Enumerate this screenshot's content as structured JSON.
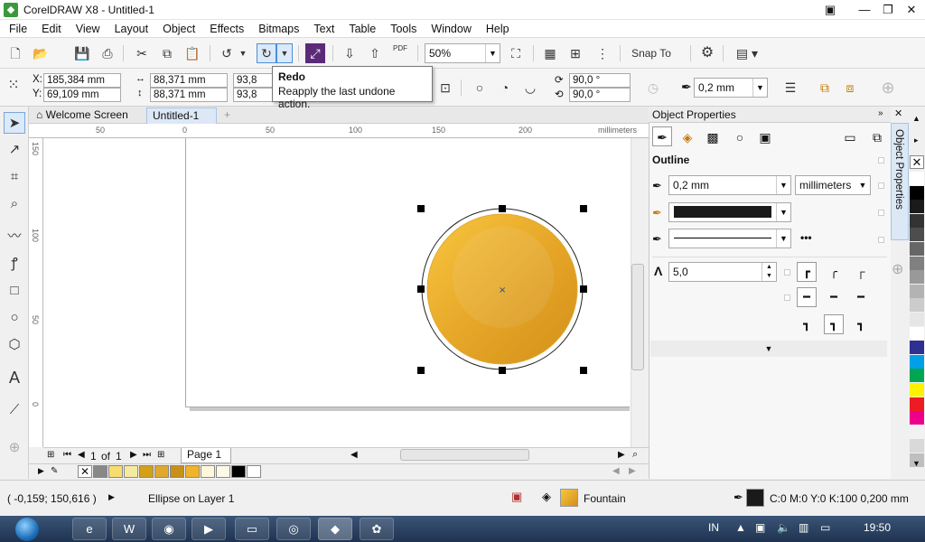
{
  "window": {
    "title": "CorelDRAW X8 - Untitled-1"
  },
  "menu": [
    "File",
    "Edit",
    "View",
    "Layout",
    "Object",
    "Effects",
    "Bitmaps",
    "Text",
    "Table",
    "Tools",
    "Window",
    "Help"
  ],
  "toolbar": {
    "zoom": "50%",
    "snap_label": "Snap To"
  },
  "tooltip": {
    "title": "Redo",
    "text": "Reapply the last undone action."
  },
  "propbar": {
    "x_label": "X:",
    "x": "185,384 mm",
    "y_label": "Y:",
    "y": "69,109 mm",
    "w": "88,371 mm",
    "h": "88,371 mm",
    "scale_w": "93,8",
    "scale_h": "93,8",
    "angle_start": "90,0 °",
    "angle_end": "90,0 °",
    "outline": "0,2 mm"
  },
  "tabs": {
    "welcome": "Welcome Screen",
    "doc": "Untitled-1"
  },
  "ruler": {
    "units": "millimeters",
    "top": [
      "50",
      "0",
      "50",
      "100",
      "150",
      "200"
    ],
    "left": [
      "150",
      "100",
      "50",
      "0"
    ]
  },
  "pagenav": {
    "current": "1",
    "of": "of",
    "total": "1",
    "page_tab": "Page 1"
  },
  "docker": {
    "title": "Object Properties",
    "section": "Outline",
    "width": "0,2 mm",
    "units": "millimeters",
    "miter": "5,0",
    "vertical_tab": "Object Properties"
  },
  "status": {
    "coords": "( -0,159; 150,616 )",
    "object": "Ellipse on Layer 1",
    "fill": "Fountain",
    "outline": "C:0 M:0 Y:0 K:100  0,200 mm"
  },
  "taskbar": {
    "lang": "IN",
    "time": "19:50"
  },
  "colors": {
    "accent": "#4b8fd6",
    "gold_light": "#f7c640",
    "gold_dark": "#d3901a",
    "palette": [
      "#ffffff",
      "#000000",
      "#1a1a1a",
      "#333333",
      "#4d4d4d",
      "#666666",
      "#808080",
      "#999999",
      "#b3b3b3",
      "#cccccc",
      "#e6e6e6",
      "#ffffff",
      "#2e3192",
      "#00a0e9",
      "#00a651",
      "#fff200",
      "#ed1c24",
      "#ec008c",
      "#f2f2f2",
      "#d9d9d9",
      "#bfbfbf"
    ],
    "doc_palette": [
      "#888888",
      "#f7dc6f",
      "#f5eaa0",
      "#d4a017",
      "#e0a82e",
      "#c8901a",
      "#f0b429",
      "#fff8dc",
      "#fef9e7",
      "#000000",
      "#ffffff"
    ]
  },
  "icons": {
    "tools": [
      "pick-tool-icon",
      "shape-tool-icon",
      "crop-tool-icon",
      "zoom-tool-icon",
      "freehand-tool-icon",
      "artistic-media-icon",
      "rectangle-tool-icon",
      "ellipse-tool-icon",
      "polygon-tool-icon",
      "text-tool-icon",
      "connector-tool-icon",
      "add-tool-icon"
    ]
  }
}
